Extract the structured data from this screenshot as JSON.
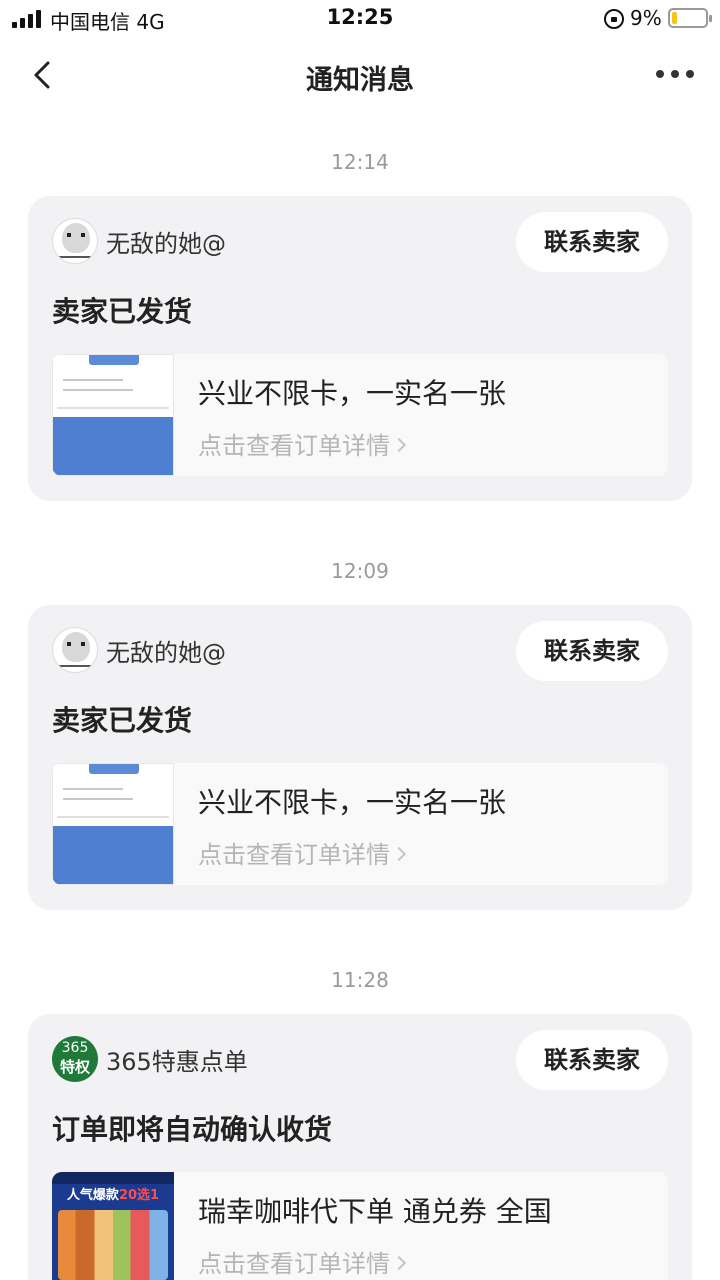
{
  "status_bar": {
    "carrier": "中国电信  4G",
    "time": "12:25",
    "battery": "9%"
  },
  "nav": {
    "title": "通知消息"
  },
  "messages": [
    {
      "time": "12:14",
      "shop": "无敌的她@",
      "contact": "联系卖家",
      "title": "卖家已发货",
      "product": "兴业不限卡，一实名一张",
      "detail": "点击查看订单详情"
    },
    {
      "time": "12:09",
      "shop": "无敌的她@",
      "contact": "联系卖家",
      "title": "卖家已发货",
      "product": "兴业不限卡，一实名一张",
      "detail": "点击查看订单详情"
    },
    {
      "time": "11:28",
      "shop": "365特惠点单",
      "contact": "联系卖家",
      "title": "订单即将自动确认收货",
      "product": "瑞幸咖啡代下单 通兑券 全国",
      "detail": "点击查看订单详情",
      "logo_top": "365",
      "logo_bottom": "特权",
      "promo_text_a": "人气爆款",
      "promo_text_b": "20选1"
    }
  ]
}
